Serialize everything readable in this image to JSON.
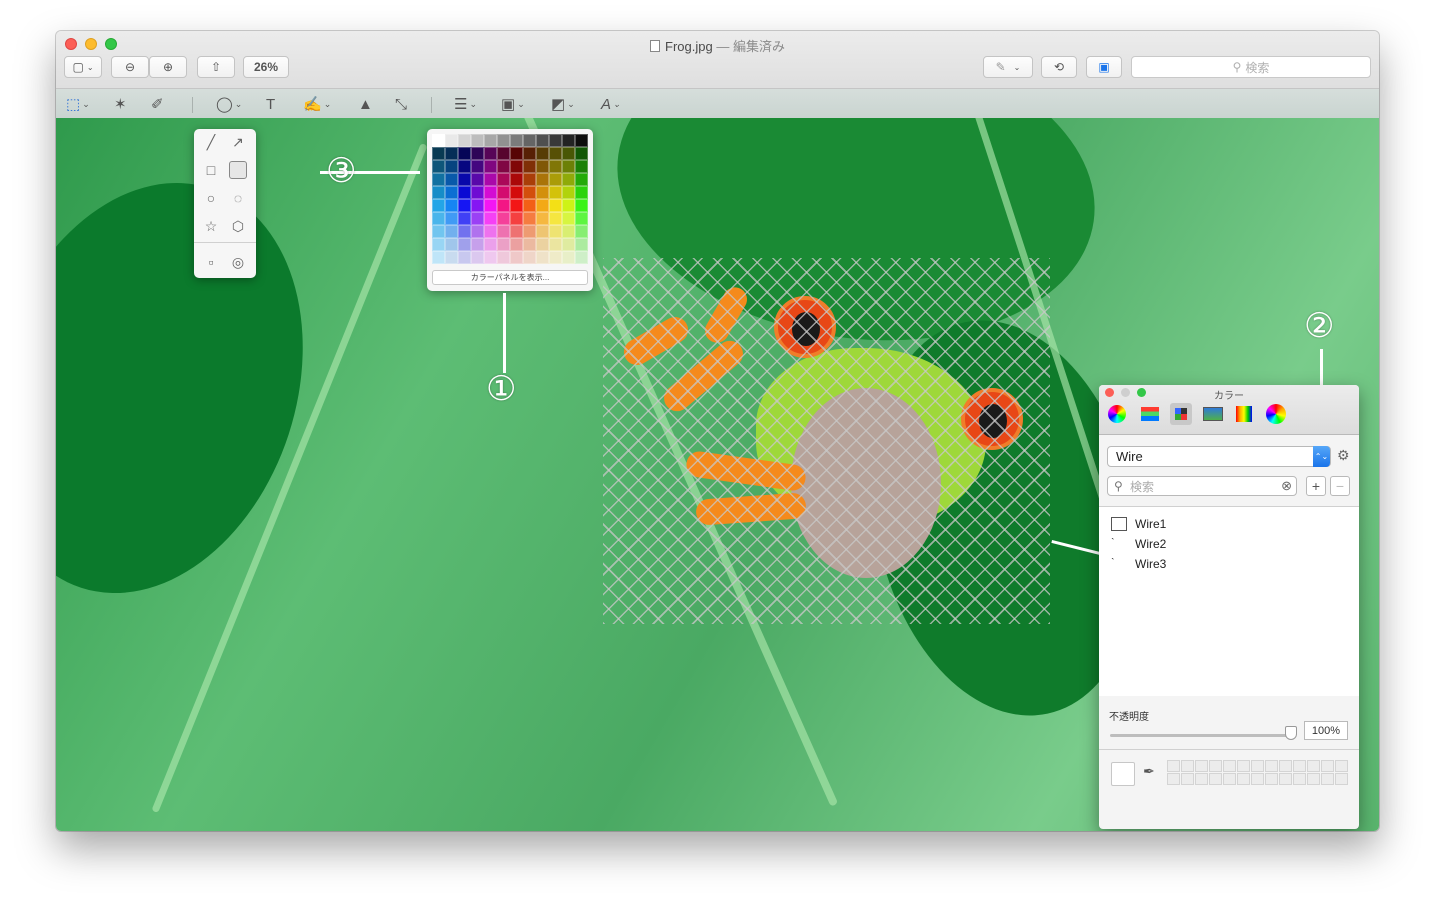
{
  "window": {
    "title": "Frog.jpg",
    "edited_sep": "—",
    "edited_label": "編集済み",
    "zoom": "26%",
    "search_placeholder": "検索"
  },
  "toolbar_icons": {
    "sidebar": "▢",
    "zoom_out": "⊖",
    "zoom_in": "⊕",
    "share": "⇧",
    "markup": "✎",
    "rotate": "⟲",
    "toolbox": "▣",
    "search": "⚲"
  },
  "markup_tools": {
    "selection": "⬚",
    "instant_alpha": "✶",
    "sketch": "✐",
    "shapes": "◯",
    "text": "T",
    "sign": "✍",
    "adjust": "▲",
    "resize": "⤡",
    "line_style": "☰",
    "border_color": "▣",
    "fill_color": "◩",
    "text_style": "A"
  },
  "shapes_popover": {
    "shapes": [
      "╱",
      "↗",
      "□",
      "▢",
      "○",
      "💬",
      "☆",
      "⬡",
      "▫",
      "◎"
    ]
  },
  "color_popover": {
    "show_panel_label": "カラーパネルを表示..."
  },
  "callouts": {
    "one": "①",
    "two": "②",
    "three": "③"
  },
  "color_panel": {
    "title": "カラー",
    "palette_name": "Wire",
    "search_placeholder": "検索",
    "add_label": "+",
    "remove_label": "−",
    "items": [
      "Wire1",
      "Wire2",
      "Wire3"
    ],
    "opacity_label": "不透明度",
    "opacity_value": "100%",
    "stepper_glyph": "⌃⌄",
    "gear_glyph": "⚙",
    "clear_glyph": "⊗",
    "eyedrop_glyph": "✒"
  },
  "colors": {
    "accent_blue": "#1a74ea",
    "leaf_green": "#4aa963"
  }
}
